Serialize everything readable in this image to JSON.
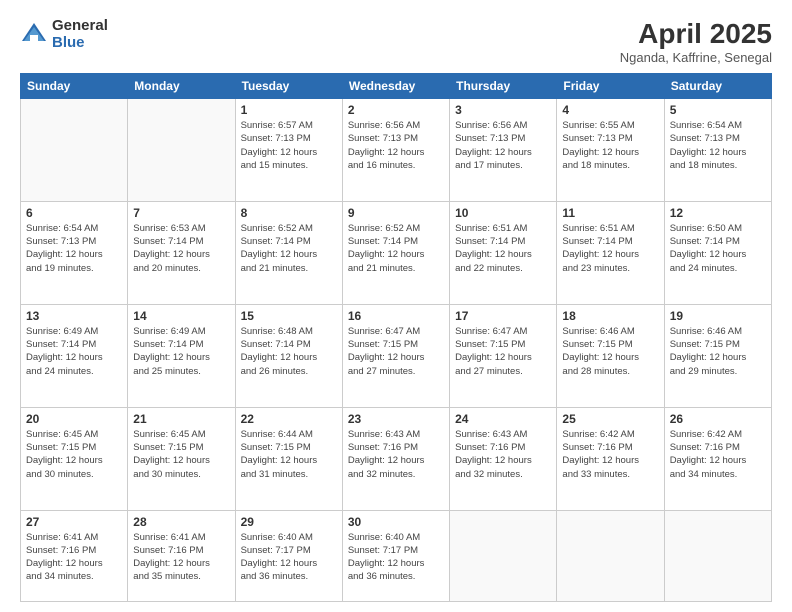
{
  "logo": {
    "general": "General",
    "blue": "Blue"
  },
  "title": {
    "month": "April 2025",
    "location": "Nganda, Kaffrine, Senegal"
  },
  "weekdays": [
    "Sunday",
    "Monday",
    "Tuesday",
    "Wednesday",
    "Thursday",
    "Friday",
    "Saturday"
  ],
  "weeks": [
    [
      {
        "day": "",
        "info": ""
      },
      {
        "day": "",
        "info": ""
      },
      {
        "day": "1",
        "info": "Sunrise: 6:57 AM\nSunset: 7:13 PM\nDaylight: 12 hours\nand 15 minutes."
      },
      {
        "day": "2",
        "info": "Sunrise: 6:56 AM\nSunset: 7:13 PM\nDaylight: 12 hours\nand 16 minutes."
      },
      {
        "day": "3",
        "info": "Sunrise: 6:56 AM\nSunset: 7:13 PM\nDaylight: 12 hours\nand 17 minutes."
      },
      {
        "day": "4",
        "info": "Sunrise: 6:55 AM\nSunset: 7:13 PM\nDaylight: 12 hours\nand 18 minutes."
      },
      {
        "day": "5",
        "info": "Sunrise: 6:54 AM\nSunset: 7:13 PM\nDaylight: 12 hours\nand 18 minutes."
      }
    ],
    [
      {
        "day": "6",
        "info": "Sunrise: 6:54 AM\nSunset: 7:13 PM\nDaylight: 12 hours\nand 19 minutes."
      },
      {
        "day": "7",
        "info": "Sunrise: 6:53 AM\nSunset: 7:14 PM\nDaylight: 12 hours\nand 20 minutes."
      },
      {
        "day": "8",
        "info": "Sunrise: 6:52 AM\nSunset: 7:14 PM\nDaylight: 12 hours\nand 21 minutes."
      },
      {
        "day": "9",
        "info": "Sunrise: 6:52 AM\nSunset: 7:14 PM\nDaylight: 12 hours\nand 21 minutes."
      },
      {
        "day": "10",
        "info": "Sunrise: 6:51 AM\nSunset: 7:14 PM\nDaylight: 12 hours\nand 22 minutes."
      },
      {
        "day": "11",
        "info": "Sunrise: 6:51 AM\nSunset: 7:14 PM\nDaylight: 12 hours\nand 23 minutes."
      },
      {
        "day": "12",
        "info": "Sunrise: 6:50 AM\nSunset: 7:14 PM\nDaylight: 12 hours\nand 24 minutes."
      }
    ],
    [
      {
        "day": "13",
        "info": "Sunrise: 6:49 AM\nSunset: 7:14 PM\nDaylight: 12 hours\nand 24 minutes."
      },
      {
        "day": "14",
        "info": "Sunrise: 6:49 AM\nSunset: 7:14 PM\nDaylight: 12 hours\nand 25 minutes."
      },
      {
        "day": "15",
        "info": "Sunrise: 6:48 AM\nSunset: 7:14 PM\nDaylight: 12 hours\nand 26 minutes."
      },
      {
        "day": "16",
        "info": "Sunrise: 6:47 AM\nSunset: 7:15 PM\nDaylight: 12 hours\nand 27 minutes."
      },
      {
        "day": "17",
        "info": "Sunrise: 6:47 AM\nSunset: 7:15 PM\nDaylight: 12 hours\nand 27 minutes."
      },
      {
        "day": "18",
        "info": "Sunrise: 6:46 AM\nSunset: 7:15 PM\nDaylight: 12 hours\nand 28 minutes."
      },
      {
        "day": "19",
        "info": "Sunrise: 6:46 AM\nSunset: 7:15 PM\nDaylight: 12 hours\nand 29 minutes."
      }
    ],
    [
      {
        "day": "20",
        "info": "Sunrise: 6:45 AM\nSunset: 7:15 PM\nDaylight: 12 hours\nand 30 minutes."
      },
      {
        "day": "21",
        "info": "Sunrise: 6:45 AM\nSunset: 7:15 PM\nDaylight: 12 hours\nand 30 minutes."
      },
      {
        "day": "22",
        "info": "Sunrise: 6:44 AM\nSunset: 7:15 PM\nDaylight: 12 hours\nand 31 minutes."
      },
      {
        "day": "23",
        "info": "Sunrise: 6:43 AM\nSunset: 7:16 PM\nDaylight: 12 hours\nand 32 minutes."
      },
      {
        "day": "24",
        "info": "Sunrise: 6:43 AM\nSunset: 7:16 PM\nDaylight: 12 hours\nand 32 minutes."
      },
      {
        "day": "25",
        "info": "Sunrise: 6:42 AM\nSunset: 7:16 PM\nDaylight: 12 hours\nand 33 minutes."
      },
      {
        "day": "26",
        "info": "Sunrise: 6:42 AM\nSunset: 7:16 PM\nDaylight: 12 hours\nand 34 minutes."
      }
    ],
    [
      {
        "day": "27",
        "info": "Sunrise: 6:41 AM\nSunset: 7:16 PM\nDaylight: 12 hours\nand 34 minutes."
      },
      {
        "day": "28",
        "info": "Sunrise: 6:41 AM\nSunset: 7:16 PM\nDaylight: 12 hours\nand 35 minutes."
      },
      {
        "day": "29",
        "info": "Sunrise: 6:40 AM\nSunset: 7:17 PM\nDaylight: 12 hours\nand 36 minutes."
      },
      {
        "day": "30",
        "info": "Sunrise: 6:40 AM\nSunset: 7:17 PM\nDaylight: 12 hours\nand 36 minutes."
      },
      {
        "day": "",
        "info": ""
      },
      {
        "day": "",
        "info": ""
      },
      {
        "day": "",
        "info": ""
      }
    ]
  ]
}
